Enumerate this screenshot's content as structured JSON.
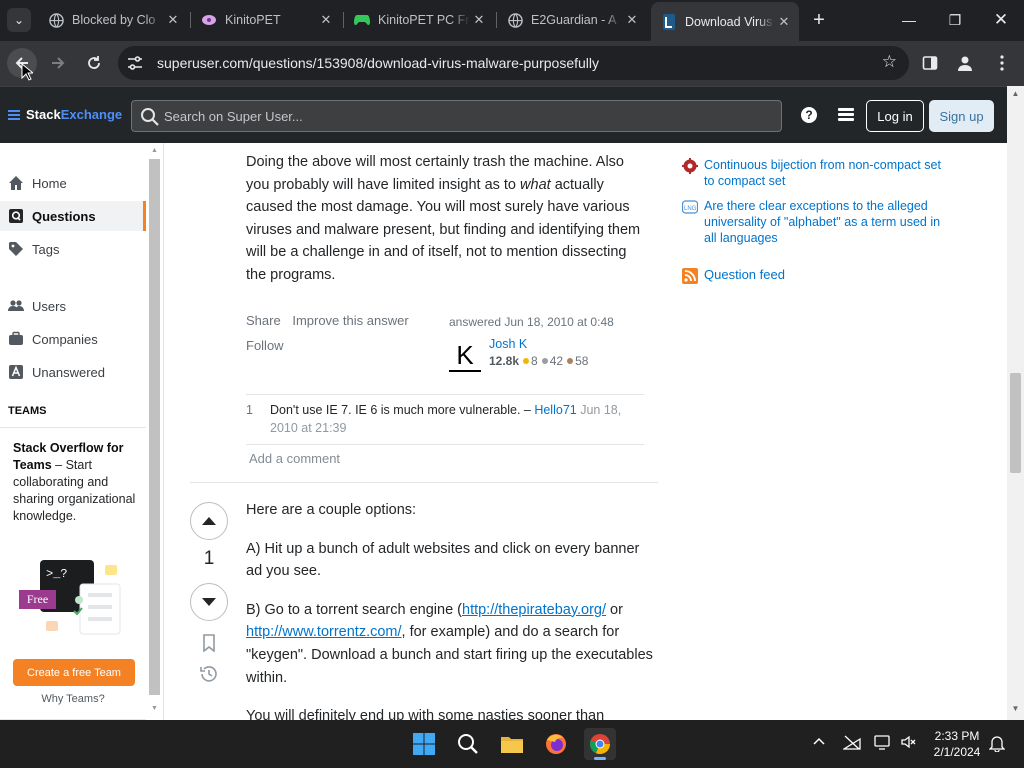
{
  "browser": {
    "tabs": [
      {
        "title": "Blocked by Clo",
        "icon": "globe-icon"
      },
      {
        "title": "KinitoPET",
        "icon": "kinito-icon"
      },
      {
        "title": "KinitoPET PC Fr",
        "icon": "gamepad-icon"
      },
      {
        "title": "E2Guardian - A",
        "icon": "globe-icon"
      },
      {
        "title": "Download Virus",
        "icon": "superuser-icon",
        "active": true
      }
    ],
    "url": "superuser.com/questions/153908/download-virus-malware-purposefully"
  },
  "topbar": {
    "logo_stack": "Stack",
    "logo_exchange": "Exchange",
    "search_placeholder": "Search on Super User...",
    "login_label": "Log in",
    "signup_label": "Sign up"
  },
  "leftnav": {
    "items": [
      {
        "label": "Home",
        "icon": "home-icon"
      },
      {
        "label": "Questions",
        "icon": "questions-icon",
        "active": true
      },
      {
        "label": "Tags",
        "icon": "tag-icon"
      },
      {
        "label": "Users",
        "icon": "users-icon"
      },
      {
        "label": "Companies",
        "icon": "briefcase-icon"
      },
      {
        "label": "Unanswered",
        "icon": "unanswered-icon"
      }
    ],
    "section": "TEAMS",
    "teams_title": "Stack Overflow for Teams",
    "teams_desc": " – Start collaborating and sharing organizational knowledge.",
    "free_badge": "Free",
    "create_label": "Create a free Team",
    "why_label": "Why Teams?"
  },
  "answer1": {
    "text_a": "Doing the above will most certainly trash the machine. Also you probably will have limited insight as to ",
    "text_em": "what",
    "text_b": " actually caused the most damage. You will most surely have various viruses and malware present, but finding and identifying them will be a challenge in and of itself, not to mention dissecting the programs.",
    "share": "Share",
    "improve": "Improve this answer",
    "follow": "Follow",
    "answered": "answered Jun 18, 2010 at 0:48",
    "user": "Josh K",
    "avatar_letter": "K",
    "rep": "12.8k",
    "gold": "8",
    "silver": "42",
    "bronze": "58",
    "comment": {
      "score": "1",
      "text": "Don't use IE 7. IE 6 is much more vulnerable.",
      "dash": " – ",
      "user": "Hello71",
      "date": "Jun 18, 2010 at 21:39"
    },
    "add_comment": "Add a comment"
  },
  "answer2": {
    "votes": "1",
    "p1": "Here are a couple options:",
    "p2": "A) Hit up a bunch of adult websites and click on every banner ad you see.",
    "p3_a": "B) Go to a torrent search engine (",
    "p3_link1": "http://thepiratebay.org/",
    "p3_b": " or ",
    "p3_link2": "http://www.torrentz.com/",
    "p3_c": ", for example) and do a search for \"keygen\". Download a bunch and start firing up the executables within.",
    "p4": "You will definitely end up with some nasties sooner than"
  },
  "sidebar": {
    "items": [
      {
        "text": "Continuous bijection from non-compact set to compact set",
        "icon": "math-site-icon"
      },
      {
        "text": "Are there clear exceptions to the alleged universality of \"alphabet\" as a term used in all languages",
        "icon": "linguistics-site-icon"
      },
      {
        "text": "Question feed",
        "icon": "rss-icon"
      }
    ]
  },
  "taskbar": {
    "time": "2:33 PM",
    "date": "2/1/2024"
  },
  "colors": {
    "accent": "#f48225",
    "link": "#0074cc",
    "topbar": "#232629",
    "chrome_dark": "#202124"
  }
}
